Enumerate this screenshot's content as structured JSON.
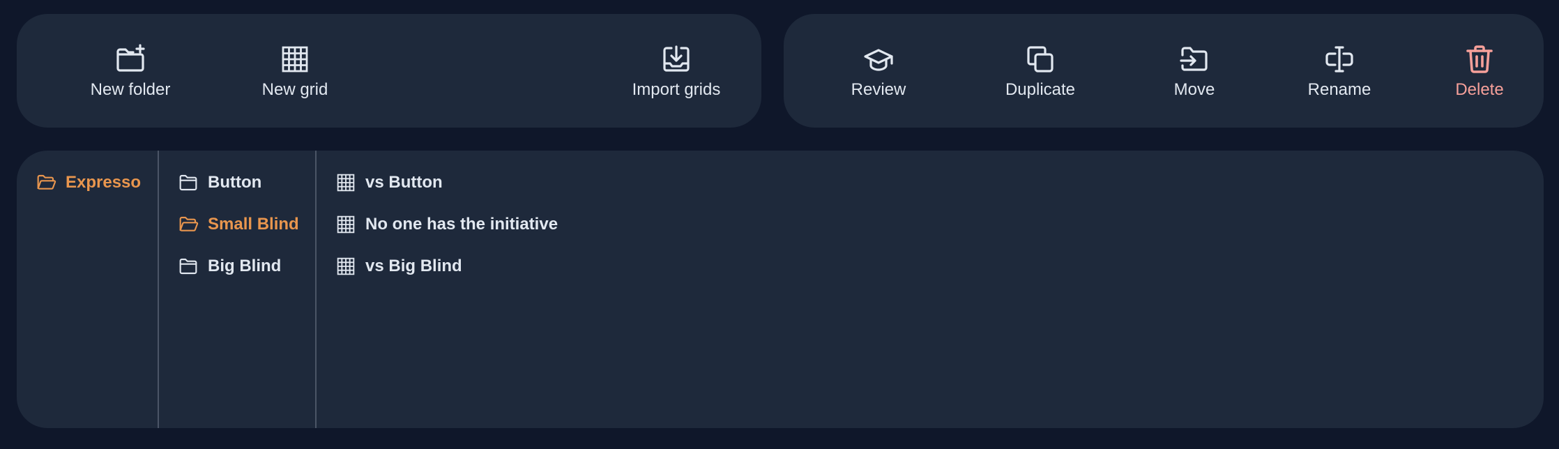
{
  "colors": {
    "background": "#0f172a",
    "panel": "#1e293b",
    "text": "#e2e8f0",
    "selected": "#e9964e",
    "danger": "#f6a09a",
    "divider": "#4b5566"
  },
  "toolbar_left": {
    "new_folder": {
      "label": "New folder",
      "icon": "folder-plus-icon"
    },
    "new_grid": {
      "label": "New grid",
      "icon": "grid-icon"
    },
    "import_grids": {
      "label": "Import grids",
      "icon": "import-icon"
    }
  },
  "toolbar_right": {
    "review": {
      "label": "Review",
      "icon": "graduation-cap-icon"
    },
    "duplicate": {
      "label": "Duplicate",
      "icon": "copy-icon"
    },
    "move": {
      "label": "Move",
      "icon": "folder-move-icon"
    },
    "rename": {
      "label": "Rename",
      "icon": "text-cursor-icon"
    },
    "delete": {
      "label": "Delete",
      "icon": "trash-icon"
    }
  },
  "browser": {
    "column1": [
      {
        "label": "Expresso",
        "icon": "folder-open-icon",
        "selected": true
      }
    ],
    "column2": [
      {
        "label": "Button",
        "icon": "folder-icon",
        "selected": false
      },
      {
        "label": "Small Blind",
        "icon": "folder-open-icon",
        "selected": true
      },
      {
        "label": "Big Blind",
        "icon": "folder-icon",
        "selected": false
      }
    ],
    "column3": [
      {
        "label": "vs Button",
        "icon": "grid-icon"
      },
      {
        "label": "No one has the initiative",
        "icon": "grid-icon"
      },
      {
        "label": "vs Big Blind",
        "icon": "grid-icon"
      }
    ]
  }
}
